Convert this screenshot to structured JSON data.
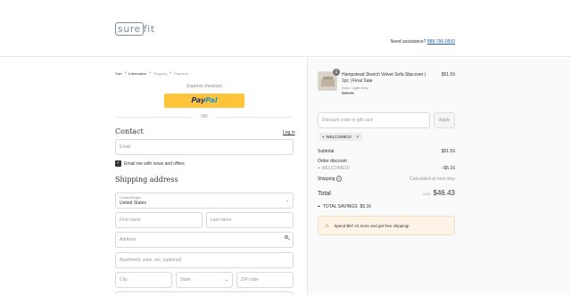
{
  "header": {
    "logo_text_boxed": "sure",
    "logo_text_rest": "fit",
    "assist_label": "Need assistance?",
    "assist_phone": "888-796-0500"
  },
  "breadcrumbs": [
    {
      "label": "Cart"
    },
    {
      "label": "Information"
    },
    {
      "label": "Shipping"
    },
    {
      "label": "Payment"
    }
  ],
  "express": {
    "label": "Express checkout",
    "paypal_pay": "Pay",
    "paypal_pal": "Pal",
    "or": "OR"
  },
  "contact": {
    "heading": "Contact",
    "login": "Log in",
    "email_placeholder": "Email",
    "news_label": "Email me with news and offers"
  },
  "shipping": {
    "heading": "Shipping address",
    "country_label": "Country/Region",
    "country_value": "United States",
    "first_name": "First name",
    "last_name": "Last name",
    "address": "Address",
    "apartment": "Apartment, suite, etc. (optional)",
    "city": "City",
    "state": "State",
    "zip": "ZIP code"
  },
  "order": {
    "product": {
      "qty": "1",
      "name": "Hampstead Stretch Velvet Sofa Slipcover | 1pc | Final Sale",
      "variant": "Sofa / Light Grey",
      "original_price": "$65.99",
      "price": "$51.59"
    },
    "discount_placeholder": "Discount code or gift card",
    "apply_label": "Apply",
    "applied_code": "WELCOME10",
    "subtotal_label": "Subtotal",
    "subtotal_value": "$51.59",
    "order_discount_label": "Order discount",
    "discount_code": "WELCOME10",
    "discount_value": "−$5.16",
    "shipping_label": "Shipping",
    "shipping_value": "Calculated at next step",
    "total_label": "Total",
    "currency": "USD",
    "total_value": "$46.43",
    "savings_label": "TOTAL SAVINGS",
    "savings_value": "$5.16",
    "notice": "Spend $67.41 more and get free shipping!"
  }
}
